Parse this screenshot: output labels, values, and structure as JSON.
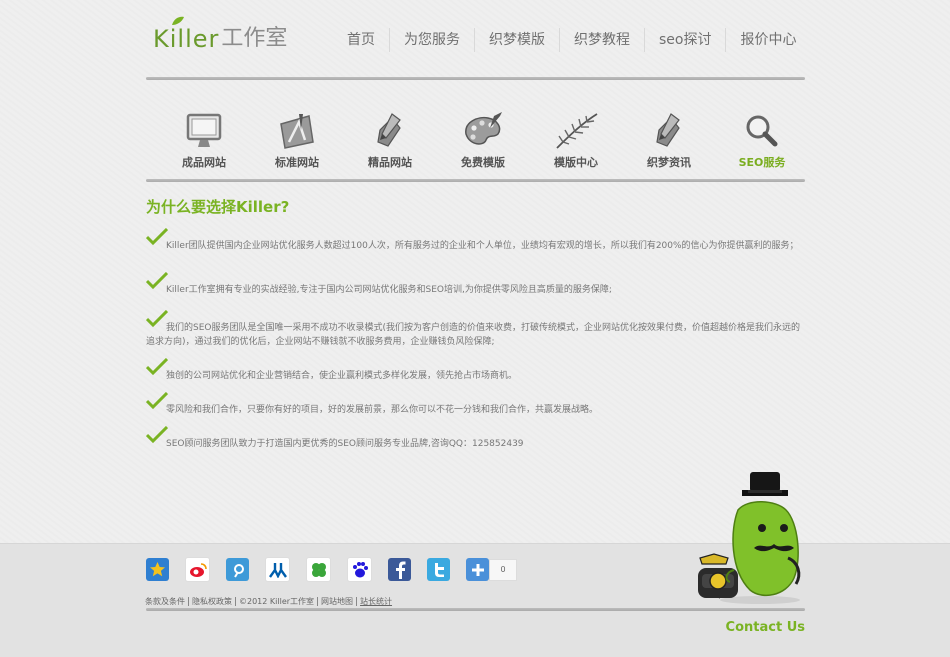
{
  "header": {
    "logo_en": "Killer",
    "logo_cn": "工作室",
    "nav": [
      "首页",
      "为您服务",
      "织梦模版",
      "织梦教程",
      "seo探讨",
      "报价中心"
    ]
  },
  "icon_nav": [
    {
      "label": "成品网站",
      "icon": "monitor-icon"
    },
    {
      "label": "标准网站",
      "icon": "design-tools-icon"
    },
    {
      "label": "精品网站",
      "icon": "pen-tablet-icon"
    },
    {
      "label": "免费模版",
      "icon": "palette-icon"
    },
    {
      "label": "模版中心",
      "icon": "fern-leaf-icon"
    },
    {
      "label": "织梦资讯",
      "icon": "pen-tablet-icon"
    },
    {
      "label": "SEO服务",
      "icon": "magnifier-icon",
      "active": true
    }
  ],
  "content": {
    "heading": "为什么要选择Killer?",
    "reasons": [
      "Killer团队提供国内企业网站优化服务人数超过100人次，所有服务过的企业和个人单位，业绩均有宏观的增长，所以我们有200%的信心为你提供赢利的服务；",
      "Killer工作室拥有专业的实战经验,专注于国内公司网站优化服务和SEO培训,为你提供零风险且高质量的服务保障;",
      "我们的SEO服务团队是全国唯一采用不成功不收录模式(我们按为客户创造的价值来收费，打破传统模式，企业网站优化按效果付费，价值超越价格是我们永远的追求方向)，通过我们的优化后，企业网站不赚钱就不收服务费用，企业赚钱负风险保障;",
      "独创的公司网站优化和企业营销结合，使企业赢利模式多样化发展，领先抢占市场商机。",
      "零风险和我们合作，只要你有好的项目，好的发展前景，那么你可以不花一分钱和我们合作，共赢发展战略。",
      "SEO顾问服务团队致力于打造国内更优秀的SEO顾问服务专业品牌,咨询QQ：125852439"
    ]
  },
  "footer": {
    "share_icons": [
      "qzone-icon",
      "weibo-icon",
      "tencent-weibo-icon",
      "renren-icon",
      "kaixin-icon",
      "baidu-icon",
      "facebook-icon",
      "twitter-icon",
      "more-share-icon"
    ],
    "share_count": "0",
    "links": [
      "条款及条件",
      "隐私权政策",
      "©2012 Killer工作室",
      "网站地图",
      "站长统计"
    ],
    "contact": "Contact Us"
  },
  "colors": {
    "accent_green": "#7ab323",
    "text_gray": "#777777",
    "background": "#efefef"
  }
}
